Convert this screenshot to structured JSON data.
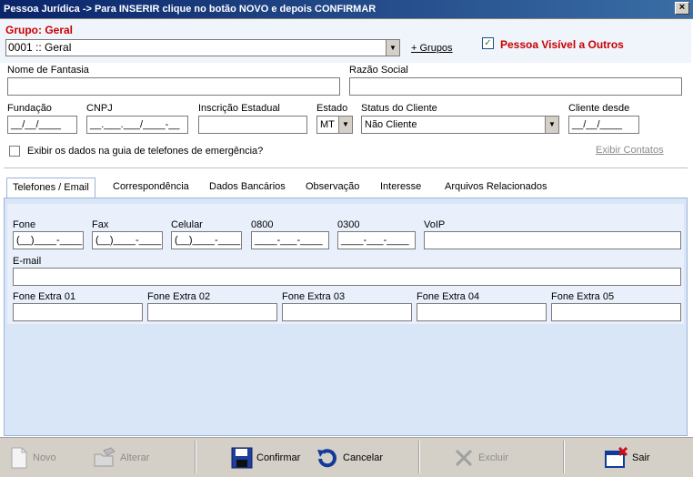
{
  "window": {
    "title": "Pessoa Jurídica -> Para INSERIR clique no botão NOVO e depois CONFIRMAR",
    "close": "×"
  },
  "header": {
    "group_title": "Grupo: Geral",
    "group_value": "0001 :: Geral",
    "add_groups": "+ Grupos",
    "visible_label": "Pessoa Visível a Outros",
    "visible_checked": "✓"
  },
  "form": {
    "fantasy_label": "Nome de Fantasia",
    "fantasy_value": "",
    "corp_label": "Razão Social",
    "corp_value": "",
    "founded_label": "Fundação",
    "founded_value": "__/__/____",
    "cnpj_label": "CNPJ",
    "cnpj_value": "__.___.___/____-__",
    "state_reg_label": "Inscrição Estadual",
    "state_label": "Estado",
    "state_value": "MT",
    "status_label": "Status do Cliente",
    "status_value": "Não Cliente",
    "since_label": "Cliente desde",
    "since_value": "__/__/____",
    "emergency_label": "Exibir os dados na guia de telefones de emergência?",
    "show_contacts": "Exibir Contatos"
  },
  "tabs": [
    "Telefones / Email",
    "Correspondência",
    "Dados Bancários",
    "Observação",
    "Interesse",
    "Arquivos Relacionados"
  ],
  "phones": {
    "fone_label": "Fone",
    "fone_value": "(__)____-____",
    "fax_label": "Fax",
    "fax_value": "(__)____-____",
    "cel_label": "Celular",
    "cel_value": "(__)____-____",
    "p0800_label": "0800",
    "p0800_value": "____-___-____",
    "p0300_label": "0300",
    "p0300_value": "____-___-____",
    "voip_label": "VoIP",
    "email_label": "E-mail",
    "extra1": "Fone Extra 01",
    "extra2": "Fone Extra 02",
    "extra3": "Fone Extra 03",
    "extra4": "Fone Extra 04",
    "extra5": "Fone Extra 05"
  },
  "toolbar": {
    "new": "Novo",
    "edit": "Alterar",
    "confirm": "Confirmar",
    "cancel": "Cancelar",
    "delete": "Excluir",
    "exit": "Sair"
  },
  "colors": {
    "group_red": "#cc0000",
    "title_bar": "#0a246a",
    "panel_blue": "#d9e6f7"
  }
}
